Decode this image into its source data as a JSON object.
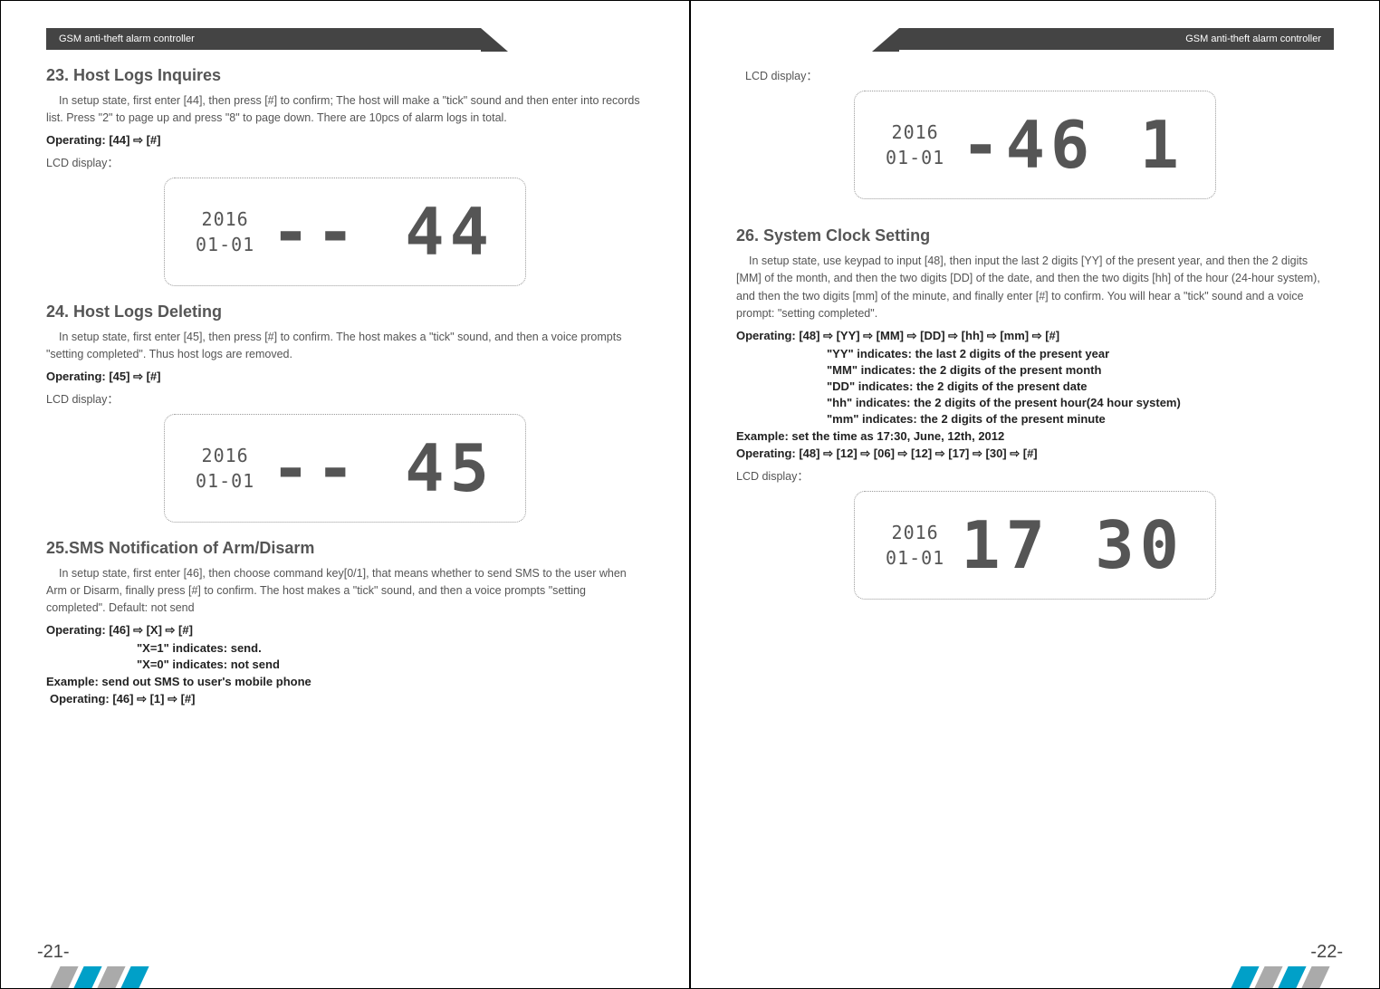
{
  "header": "GSM anti-theft alarm controller",
  "pageLeft": "-21-",
  "pageRight": "-22-",
  "lcd": {
    "year": "2016",
    "date": "01-01"
  },
  "s23": {
    "title": "23. Host Logs Inquires",
    "body": "In setup state, first enter [44], then press [#] to confirm; The host will make a \"tick\" sound and then enter into records list. Press \"2\" to page up and press \"8\" to page down. There are 10pcs of alarm logs in total.",
    "op": "Operating: [44] ⇨ [#]",
    "lcdLabel": "LCD display：",
    "big": "-- 44"
  },
  "s24": {
    "title": "24. Host Logs Deleting",
    "body": "In setup state, first enter [45], then press [#] to confirm. The host makes a \"tick\" sound, and then a voice prompts \"setting completed\". Thus host logs are removed.",
    "op": "Operating: [45] ⇨ [#]",
    "lcdLabel": "LCD display：",
    "big": "-- 45"
  },
  "s25": {
    "title": "25.SMS Notification of Arm/Disarm",
    "body": "In setup state, first enter [46], then choose command key[0/1], that means whether to send SMS to the user when Arm or Disarm, finally press [#] to confirm. The host makes a \"tick\" sound, and then a voice prompts \"setting completed\". Default: not send",
    "op": "Operating: [46] ⇨ [X] ⇨ [#]",
    "x1": "\"X=1\" indicates: send.",
    "x0": "\"X=0\" indicates: not send",
    "ex": "Example: send out SMS to user's mobile phone",
    "op2": "Operating: [46] ⇨ [1] ⇨ [#]",
    "lcdLabel": "LCD display：",
    "big": "-46 1"
  },
  "s26": {
    "title": "26. System Clock Setting",
    "body": "In setup state, use keypad to input [48], then input the last 2 digits [YY] of the present year, and then the 2 digits [MM] of the month, and then the two digits [DD] of the date, and then the two digits [hh] of the hour (24-hour system), and then the two digits [mm] of the minute, and finally enter [#] to confirm. You will hear a \"tick\" sound and a voice prompt: \"setting completed\".",
    "op": "Operating: [48] ⇨ [YY] ⇨ [MM] ⇨ [DD] ⇨ [hh] ⇨ [mm] ⇨ [#]",
    "yy": "\"YY\" indicates: the last 2 digits of the present year",
    "mm": "\"MM\" indicates: the 2 digits of the present month",
    "dd": "\"DD\" indicates: the 2 digits of the present date",
    "hh": "\"hh\" indicates: the 2 digits of the present hour(24 hour system)",
    "mn": "\"mm\" indicates: the 2 digits of the present minute",
    "ex": "Example: set the time as 17:30, June, 12th, 2012",
    "op2": "Operating: [48] ⇨ [12] ⇨ [06] ⇨ [12] ⇨ [17] ⇨ [30] ⇨ [#]",
    "lcdLabel": "LCD display：",
    "big": "17 30"
  }
}
